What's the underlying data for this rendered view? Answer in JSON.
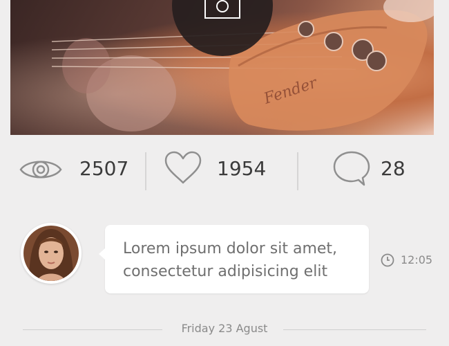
{
  "hero": {
    "image_desc": "guitar-headstock-photo",
    "camera_icon": "camera-icon"
  },
  "stats": {
    "views": {
      "icon": "eye-icon",
      "value": "2507"
    },
    "likes": {
      "icon": "heart-icon",
      "value": "1954"
    },
    "comments": {
      "icon": "speech-bubble-icon",
      "value": "28"
    }
  },
  "message": {
    "avatar": "avatar",
    "text": "Lorem ipsum dolor sit amet, consectetur adipisicing elit",
    "time_icon": "clock-icon",
    "time": "12:05"
  },
  "date_separator": {
    "label": "Friday 23 Agust"
  },
  "colors": {
    "background": "#efeeee",
    "text": "#3a3a3a",
    "muted": "#8a8a8a",
    "icon_stroke": "#8f8f8f"
  }
}
